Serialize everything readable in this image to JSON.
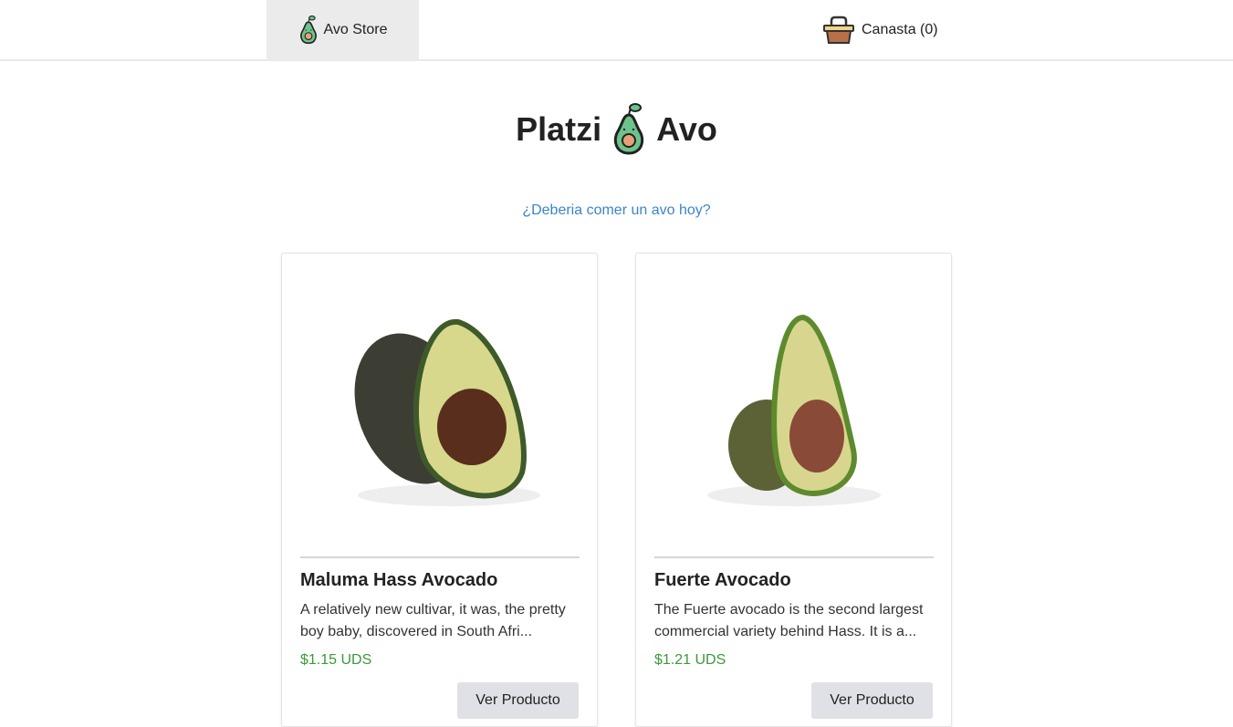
{
  "nav": {
    "home_label": "Avo Store",
    "cart_label": "Canasta (0)"
  },
  "header": {
    "title_left": "Platzi",
    "title_right": "Avo"
  },
  "link": "¿Deberia comer un avo hoy?",
  "products": [
    {
      "name": "Maluma Hass Avocado",
      "description": "A relatively new cultivar, it was, the pretty boy baby, discovered in South Afri...",
      "price": "$1.15 UDS",
      "button": "Ver Producto"
    },
    {
      "name": "Fuerte Avocado",
      "description": "The Fuerte avocado is the second largest commercial variety behind Hass. It is a...",
      "price": "$1.21 UDS",
      "button": "Ver Producto"
    }
  ],
  "colors": {
    "accent_link": "#3a86c8",
    "price": "#3a9a3a"
  }
}
